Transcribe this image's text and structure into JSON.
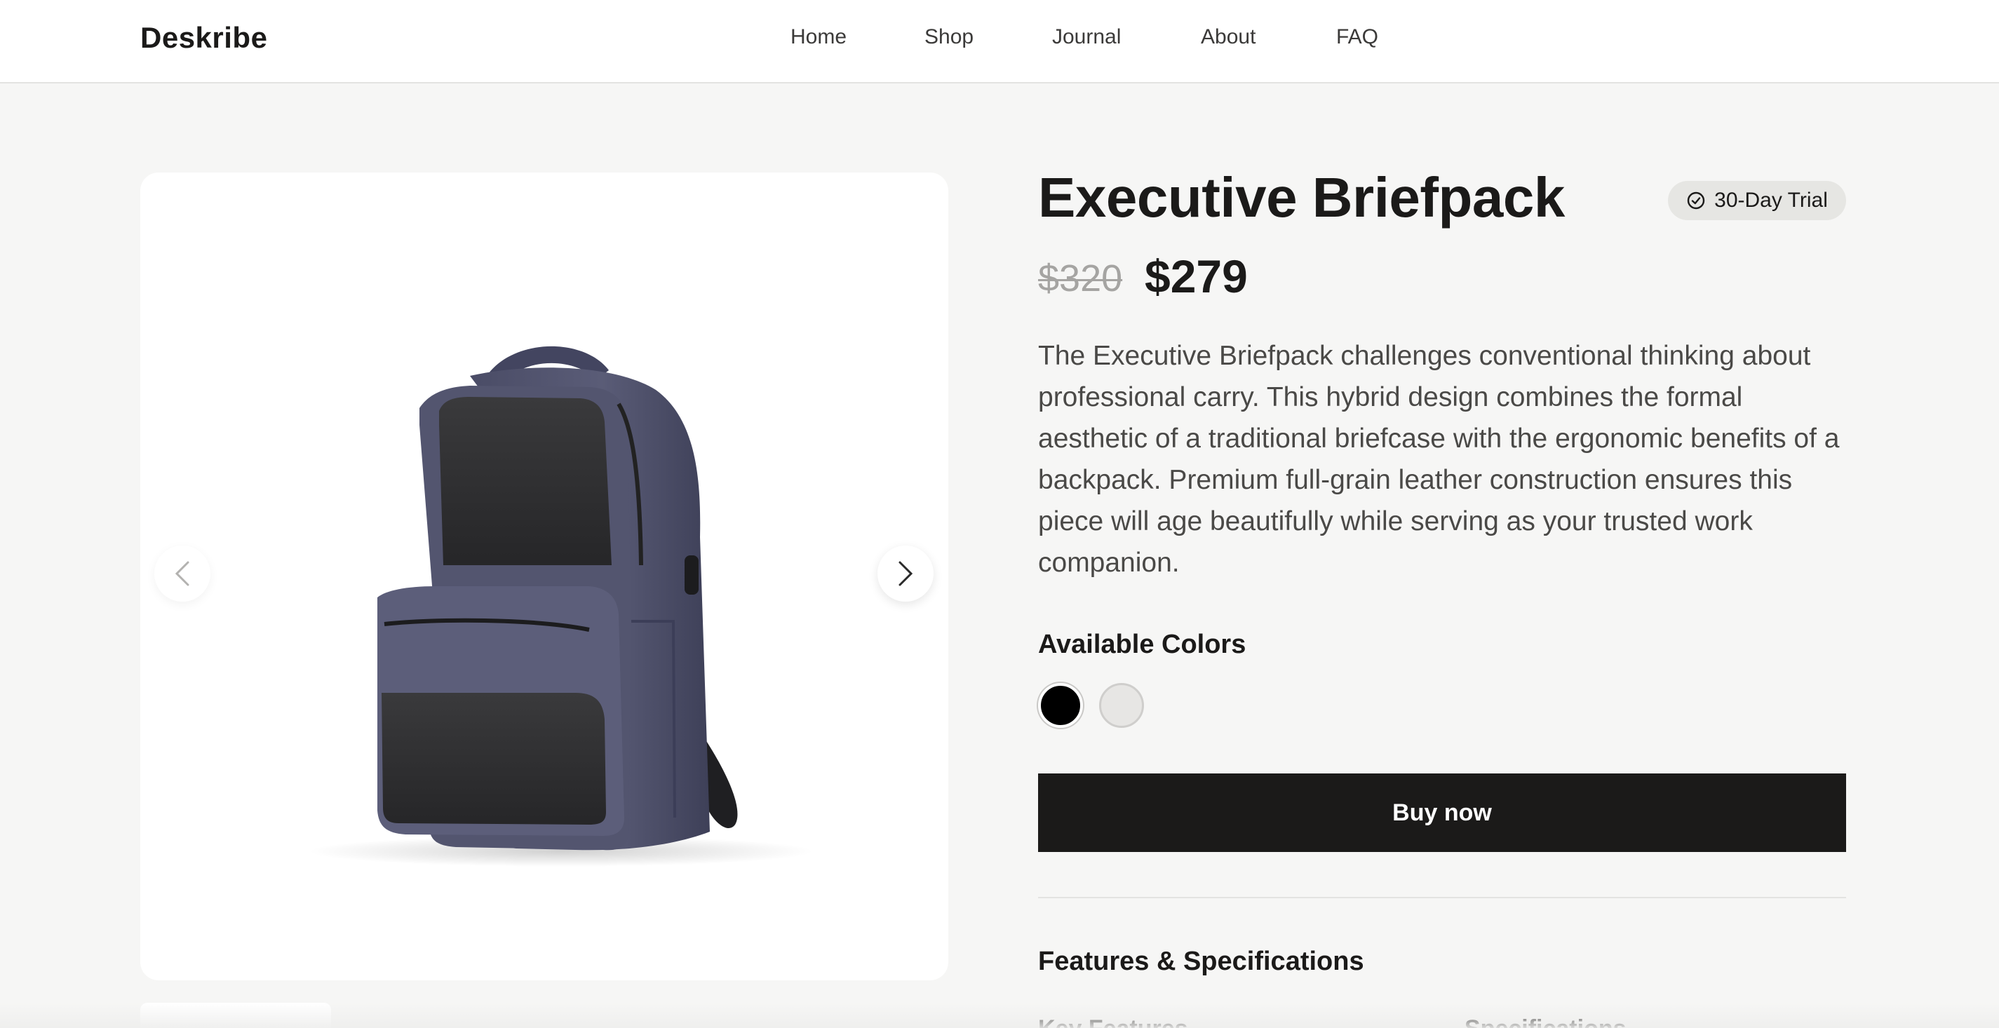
{
  "header": {
    "logo": "Deskribe",
    "nav": [
      {
        "label": "Home"
      },
      {
        "label": "Shop"
      },
      {
        "label": "Journal"
      },
      {
        "label": "About"
      },
      {
        "label": "FAQ"
      }
    ]
  },
  "gallery": {
    "image_icon": "backpack-illustration",
    "prev_icon": "chevron-left-icon",
    "next_icon": "chevron-right-icon"
  },
  "product": {
    "title": "Executive Briefpack",
    "badge": "30-Day Trial",
    "badge_icon": "check-circle-icon",
    "old_price": "$320",
    "price": "$279",
    "description": "The Executive Briefpack challenges conventional thinking about professional carry. This hybrid design combines the formal aesthetic of a traditional briefcase with the ergonomic benefits of a backpack. Premium full-grain leather construction ensures this piece will age beautifully while serving as your trusted work companion.",
    "colors_heading": "Available Colors",
    "colors": [
      {
        "name": "Black",
        "hex": "#000000",
        "selected": true
      },
      {
        "name": "Light Gray",
        "hex": "#e7e6e4",
        "selected": false
      }
    ],
    "buy_label": "Buy now",
    "features_heading": "Features & Specifications",
    "key_features_heading": "Key Features",
    "specifications_heading": "Specifications"
  },
  "colors": {
    "accent": "#1b1a19",
    "page_bg": "#f6f6f5",
    "muted_price": "#a5a4a2",
    "backpack_body": "#545670",
    "backpack_panel": "#2e2e30"
  }
}
